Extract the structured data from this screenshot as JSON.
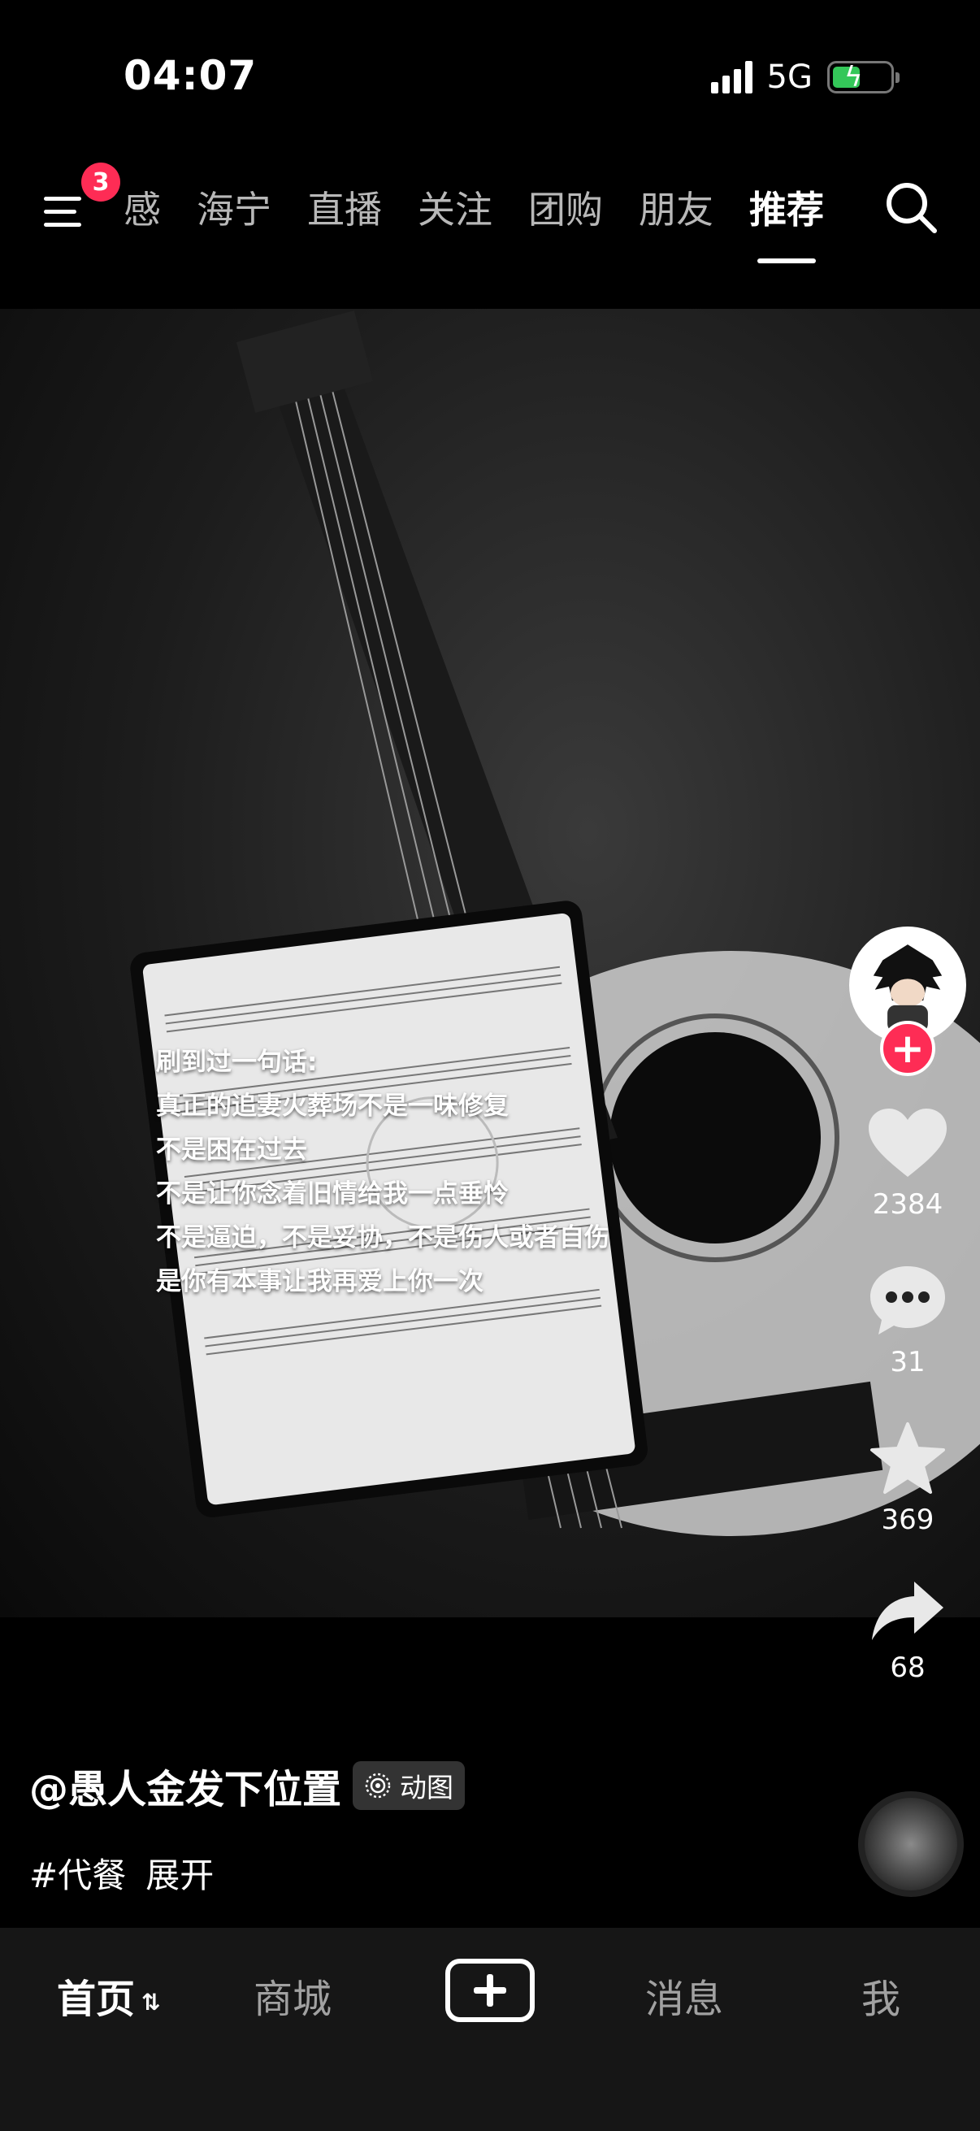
{
  "status": {
    "time": "04:07",
    "network": "5G"
  },
  "top_nav": {
    "menu_badge": "3",
    "tabs": [
      "感",
      "海宁",
      "直播",
      "关注",
      "团购",
      "朋友",
      "推荐"
    ],
    "active_tab": "推荐"
  },
  "video": {
    "overlay_lines": [
      "刷到过一句话:",
      "真正的追妻火葬场不是一味修复",
      "不是困在过去",
      "不是让你念着旧情给我一点垂怜",
      "不是逼迫，不是妥协，不是伤人或者自伤",
      "是你有本事让我再爱上你一次"
    ]
  },
  "actions": {
    "likes": "2384",
    "comments": "31",
    "favorites": "369",
    "shares": "68"
  },
  "caption": {
    "author": "@愚人金发下位置",
    "chip": "动图",
    "hashtag": "#代餐",
    "expand": "展开"
  },
  "bottom_nav": {
    "home": "首页",
    "mall": "商城",
    "messages": "消息",
    "me": "我"
  },
  "colors": {
    "accent": "#fe2c55",
    "battery": "#34c759"
  }
}
